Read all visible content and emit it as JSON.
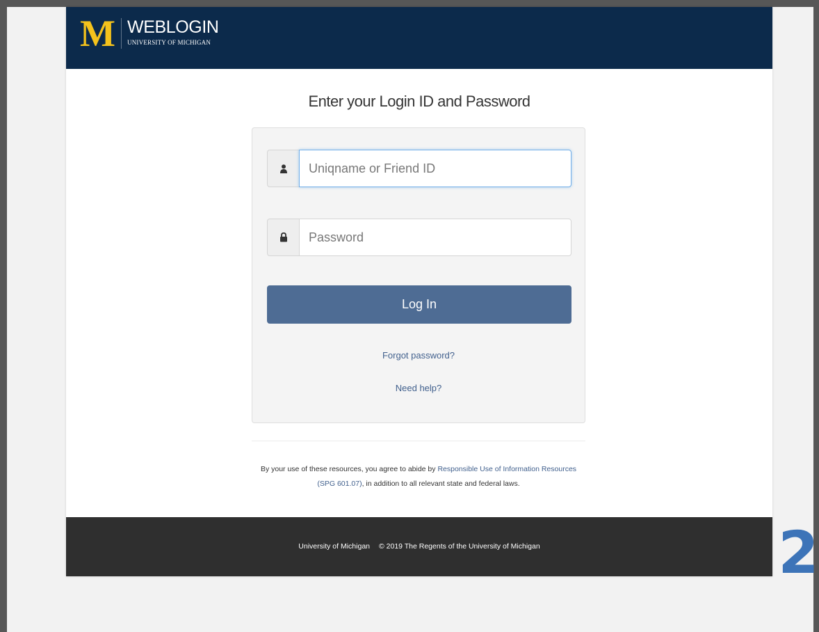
{
  "header": {
    "logo_text": "M",
    "title": "WEBLOGIN",
    "subtitle": "UNIVERSITY OF MICHIGAN"
  },
  "main": {
    "heading": "Enter your Login ID and Password",
    "login_form": {
      "uniqname_placeholder": "Uniqname or Friend ID",
      "password_placeholder": "Password",
      "login_button_label": "Log In",
      "forgot_password_link": "Forgot password?",
      "need_help_link": "Need help?"
    },
    "terms": {
      "prefix": "By your use of these resources, you agree to abide by ",
      "link_text": "Responsible Use of Information Resources (SPG 601.07)",
      "suffix": ", in addition to all relevant state and federal laws."
    }
  },
  "footer": {
    "university": "University of Michigan",
    "copyright": "© 2019",
    "regents": "The Regents of the University of Michigan"
  },
  "overlay": {
    "step_number": "2"
  },
  "icons": {
    "user": "user-icon",
    "lock": "lock-icon"
  },
  "colors": {
    "header": "#0c2a4b",
    "logo": "#f4c21c",
    "button": "#4e6c94",
    "link": "#41608d",
    "footer": "#2f2f2f",
    "step_number": "#3d74b8"
  }
}
